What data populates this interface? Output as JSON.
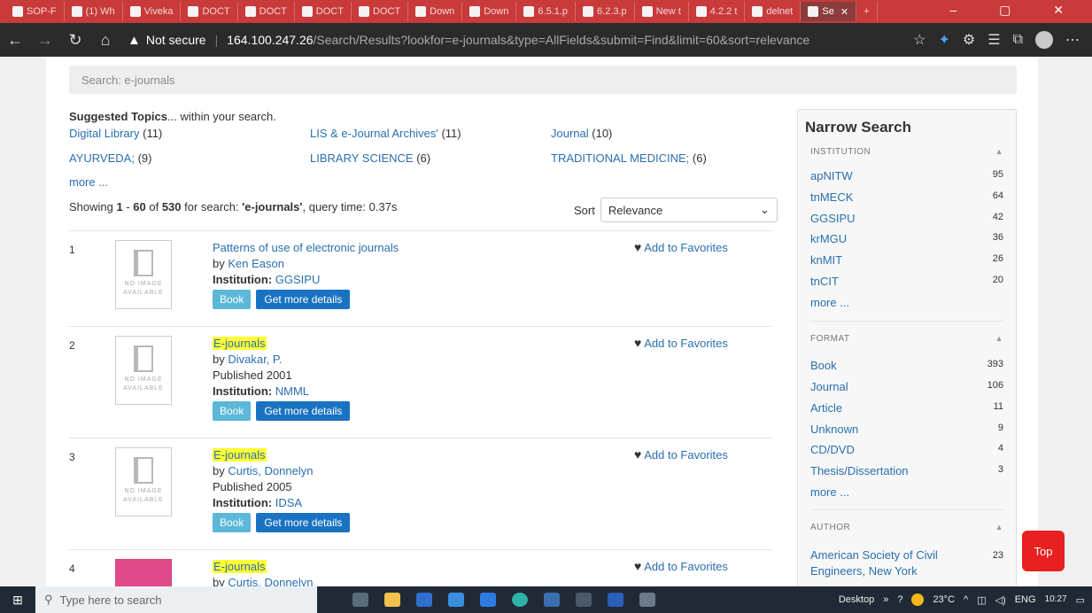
{
  "browser": {
    "tabs": [
      {
        "label": "SOP-F"
      },
      {
        "label": "(1) Wh"
      },
      {
        "label": "Viveka"
      },
      {
        "label": "DOCT"
      },
      {
        "label": "DOCT"
      },
      {
        "label": "DOCT"
      },
      {
        "label": "DOCT"
      },
      {
        "label": "Down"
      },
      {
        "label": "Down"
      },
      {
        "label": "6.5.1.p"
      },
      {
        "label": "6.2.3.p"
      },
      {
        "label": "New t"
      },
      {
        "label": "4.2.2 t"
      },
      {
        "label": "delnet"
      },
      {
        "label": "Se"
      }
    ],
    "new_tab": "+",
    "window_controls": "–  ▢  ✕",
    "security_label": "Not secure",
    "url_host": "164.100.247.26",
    "url_path": "/Search/Results?lookfor=e-journals&type=AllFields&submit=Find&limit=60&sort=relevance"
  },
  "search": {
    "query_display": "Search: e-journals"
  },
  "suggested": {
    "heading_bold": "Suggested Topics",
    "heading_rest": "... within your search.",
    "topics": [
      {
        "label": "Digital Library",
        "count": "(11)"
      },
      {
        "label": "LIS & e-Journal Archives'",
        "count": "(11)"
      },
      {
        "label": "Journal",
        "count": "(10)"
      },
      {
        "label": "AYURVEDA;",
        "count": "(9)"
      },
      {
        "label": "LIBRARY SCIENCE",
        "count": "(6)"
      },
      {
        "label": "TRADITIONAL MEDICINE;",
        "count": "(6)"
      }
    ],
    "more": "more ..."
  },
  "summary": {
    "prefix": "Showing ",
    "from": "1",
    "dash": " - ",
    "to": "60",
    "of": " of ",
    "total": "530",
    "for": " for search: ",
    "term": "'e-journals'",
    "rest": ", query time: 0.37s"
  },
  "sort": {
    "label": "Sort",
    "value": "Relevance"
  },
  "thumb": {
    "noimg_line1": "NO IMAGE",
    "noimg_line2": "AVAILABLE"
  },
  "results": [
    {
      "num": "1",
      "title": "Patterns of use of electronic journals",
      "by": "by ",
      "author": "Ken Eason",
      "published": "",
      "inst_label": "Institution: ",
      "institution": "GGSIPU",
      "format": "Book",
      "details": "Get more details",
      "fav": "Add to Favorites"
    },
    {
      "num": "2",
      "title": "E-journals",
      "by": "by ",
      "author": "Divakar, P.",
      "published": "Published 2001",
      "inst_label": "Institution: ",
      "institution": "NMML",
      "format": "Book",
      "details": "Get more details",
      "fav": "Add to Favorites"
    },
    {
      "num": "3",
      "title": "E-journals",
      "by": "by ",
      "author": "Curtis, Donnelyn",
      "published": "Published 2005",
      "inst_label": "Institution: ",
      "institution": "IDSA",
      "format": "Book",
      "details": "Get more details",
      "fav": "Add to Favorites"
    },
    {
      "num": "4",
      "title": "E-journals",
      "by": "by ",
      "author": "Curtis, Donnelyn",
      "published": "",
      "inst_label": "",
      "institution": "",
      "format": "",
      "details": "",
      "fav": "Add to Favorites"
    }
  ],
  "sidebar": {
    "title": "Narrow Search",
    "institution": {
      "heading": "INSTITUTION",
      "items": [
        {
          "label": "apNITW",
          "count": "95"
        },
        {
          "label": "tnMECK",
          "count": "64"
        },
        {
          "label": "GGSIPU",
          "count": "42"
        },
        {
          "label": "krMGU",
          "count": "36"
        },
        {
          "label": "knMIT",
          "count": "26"
        },
        {
          "label": "tnCIT",
          "count": "20"
        }
      ],
      "more": "more ..."
    },
    "format": {
      "heading": "FORMAT",
      "items": [
        {
          "label": "Book",
          "count": "393"
        },
        {
          "label": "Journal",
          "count": "106"
        },
        {
          "label": "Article",
          "count": "11"
        },
        {
          "label": "Unknown",
          "count": "9"
        },
        {
          "label": "CD/DVD",
          "count": "4"
        },
        {
          "label": "Thesis/Dissertation",
          "count": "3"
        }
      ],
      "more": "more ..."
    },
    "author": {
      "heading": "AUTHOR",
      "items": [
        {
          "label_line1": "American Society of Civil",
          "label_line2": "Engineers, New York",
          "count": "23"
        }
      ]
    }
  },
  "top_button": "Top",
  "taskbar": {
    "search_placeholder": "Type here to search",
    "desktop_label": "Desktop",
    "overflow": "»",
    "weather": "23°C",
    "lang": "ENG",
    "time": "10:27"
  },
  "colors": {
    "link": "#2a6fb0",
    "highlight": "#ffff33",
    "top_button": "#e8201f",
    "details_button": "#1a73c2",
    "format_button": "#5bb8d8"
  }
}
